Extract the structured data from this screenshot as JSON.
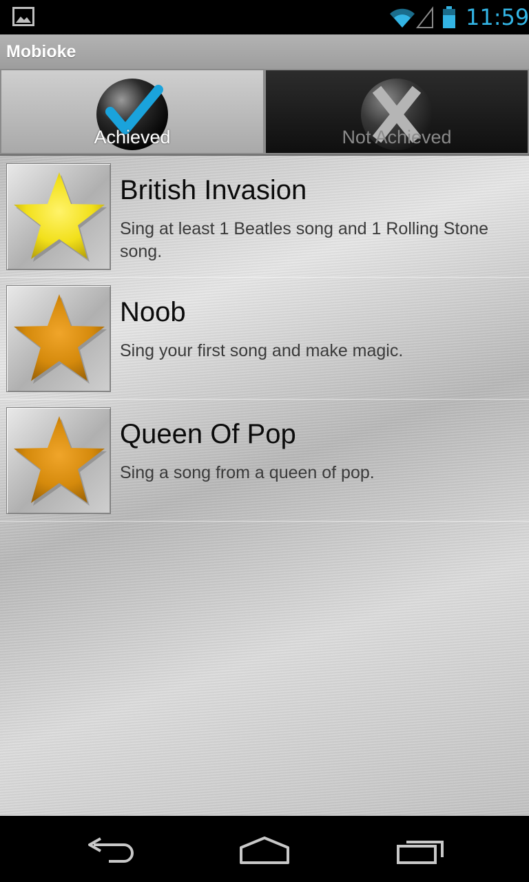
{
  "status_bar": {
    "time": "11:59",
    "icons": [
      "gallery-notification-icon",
      "wifi-icon",
      "cell-signal-icon",
      "battery-icon"
    ],
    "time_color": "#33b5e5"
  },
  "app": {
    "title": "Mobioke"
  },
  "tabs": [
    {
      "label": "Achieved",
      "icon": "checkmark-icon",
      "selected": true
    },
    {
      "label": "Not Achieved",
      "icon": "x-mark-icon",
      "selected": false
    }
  ],
  "achievements": [
    {
      "title": "British Invasion",
      "description": "Sing at least 1 Beatles song and 1 Rolling Stone song.",
      "icon": "star-icon",
      "star_color": "#f2e01b"
    },
    {
      "title": "Noob",
      "description": "Sing your first song and make magic.",
      "icon": "star-icon",
      "star_color": "#d58a0c"
    },
    {
      "title": "Queen Of Pop",
      "description": "Sing a song from a queen of pop.",
      "icon": "star-icon",
      "star_color": "#d58a0c"
    }
  ],
  "nav_bar": {
    "buttons": [
      "back-icon",
      "home-icon",
      "recent-apps-icon"
    ]
  }
}
